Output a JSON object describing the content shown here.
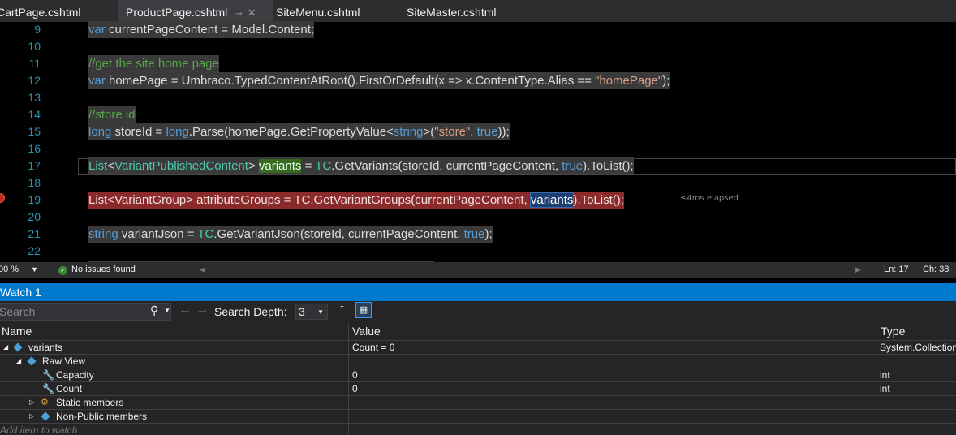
{
  "tabs": [
    {
      "label": "CartPage.cshtml",
      "active": false
    },
    {
      "label": "ProductPage.cshtml",
      "active": true
    },
    {
      "label": "SiteMenu.cshtml",
      "active": false
    },
    {
      "label": "SiteMaster.cshtml",
      "active": false
    }
  ],
  "tab_pin_glyph": "⊸",
  "tab_close_glyph": "✕",
  "lines": [
    "9",
    "10",
    "11",
    "12",
    "13",
    "14",
    "15",
    "16",
    "17",
    "18",
    "19",
    "20",
    "21",
    "22"
  ],
  "code": {
    "l9_kw": "var",
    "l9_rest": " currentPageContent = Model.Content;",
    "l11": "//get the site home page",
    "l12_kw": "var",
    "l12_a": " homePage = Umbraco.TypedContentAtRoot().FirstOrDefault(x => x.ContentType.Alias == ",
    "l12_str": "\"homePage\"",
    "l12_b": ");",
    "l14": "//store id",
    "l15_kw": "long",
    "l15_a": " storeId = ",
    "l15_kw2": "long",
    "l15_b": ".Parse(homePage.GetPropertyValue<",
    "l15_kw3": "string",
    "l15_c": ">(",
    "l15_str": "\"store\"",
    "l15_d": ", ",
    "l15_kw4": "true",
    "l15_e": "));",
    "l17_ty": "List",
    "l17_a": "<",
    "l17_ty2": "VariantPublishedContent",
    "l17_b": "> ",
    "l17_var": "variants",
    "l17_c": " = ",
    "l17_ty3": "TC",
    "l17_d": ".GetVariants(storeId, currentPageContent, ",
    "l17_kw": "true",
    "l17_e": ").ToList();",
    "l19_a": "List<VariantGroup> attributeGroups = TC.GetVariantGroups(currentPageContent, ",
    "l19_var": "variants",
    "l19_b": ").ToList();",
    "l21_kw": "string",
    "l21_a": " variantJson = ",
    "l21_ty": "TC",
    "l21_b": ".GetVariantJson(storeId, currentPageContent, ",
    "l21_kw2": "true",
    "l21_c": ");"
  },
  "elapsed": "≤4ms elapsed",
  "status": {
    "zoom": "00 %",
    "issues": "No issues found",
    "ln": "Ln: 17",
    "ch": "Ch: 38"
  },
  "watch": {
    "title": "Watch 1",
    "search_placeholder": "Search",
    "search_depth_label": "Search Depth:",
    "search_depth_value": "3",
    "columns": {
      "name": "Name",
      "value": "Value",
      "type": "Type"
    },
    "rows": [
      {
        "name": "variants",
        "value": "Count = 0",
        "type": "System.Collection"
      },
      {
        "name": "Raw View",
        "value": "",
        "type": ""
      },
      {
        "name": "Capacity",
        "value": "0",
        "type": "int"
      },
      {
        "name": "Count",
        "value": "0",
        "type": "int"
      },
      {
        "name": "Static members",
        "value": "",
        "type": ""
      },
      {
        "name": "Non-Public members",
        "value": "",
        "type": ""
      }
    ],
    "add_item": "Add item to watch"
  },
  "colors": {
    "accent": "#007acc",
    "error_line": "#8b2a2a",
    "keyword": "#569cd6",
    "type": "#4ec9b0",
    "string": "#d69d85",
    "comment": "#57a64a"
  }
}
